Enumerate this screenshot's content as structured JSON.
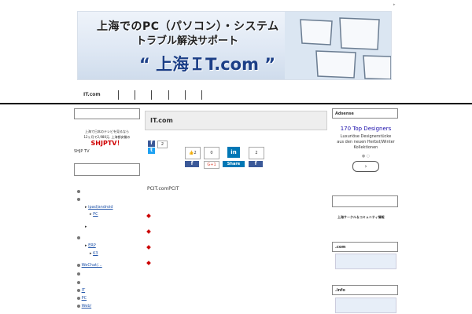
{
  "corner_mark": "▸",
  "banner": {
    "line1": "上海でのPC（パソコン）・システム",
    "line2": "トラブル解決サポート",
    "line3": "“ 上海ＩT.com ”"
  },
  "nav": {
    "items": [
      "IT.com",
      "",
      "",
      "",
      "",
      "",
      ""
    ]
  },
  "left": {
    "ad_line1": "上海で日本のテレビを見るなら",
    "ad_line2": "12ヶ月で2,980元. 上海都安徽の",
    "ad_big": "SHJPTV！",
    "shjp_label": "SHJP TV",
    "tree": {
      "ipad": "ipad/android",
      "pc_sub": "PC",
      "erp": "ERP",
      "k3": "K3",
      "wechat": "WeChat/…",
      "it": "IT",
      "pc": "PC",
      "web": "Web/"
    }
  },
  "main": {
    "title": "IT.com",
    "fb_count": "2",
    "like_count": "2",
    "zero_count": "0",
    "li_count": "2",
    "share_label": "Share",
    "gplus_label": "G+1",
    "body_text": "PCIT.comPCIT"
  },
  "right": {
    "adsense_label": "Adsense",
    "ad_title": "170 Top Designers",
    "ad_text": "Luxuriöse Designerstücke aus den neuen Herbst/Winter Kollektionen",
    "community_label": "上海サークル＆コミュニティ情報",
    "com_label": ".com",
    "info_label": ".info"
  },
  "colors": {
    "accent_red": "#d00000",
    "facebook": "#3b5998",
    "link": "#2255aa"
  }
}
